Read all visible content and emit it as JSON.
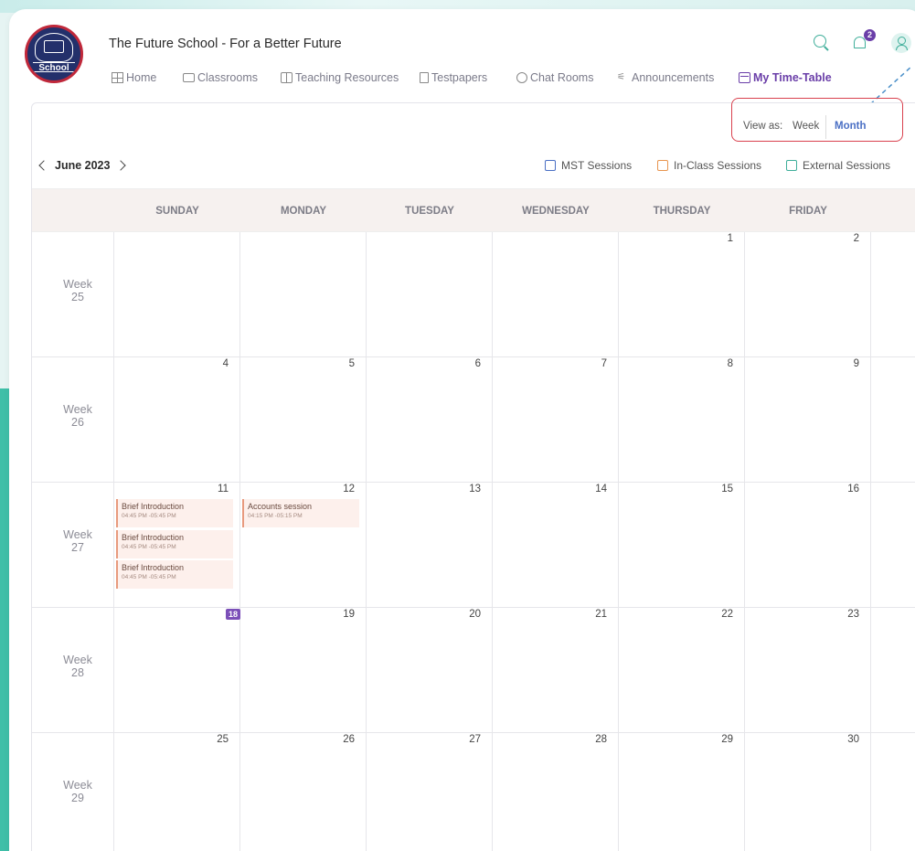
{
  "header": {
    "school_title": "The Future School - For a Better Future",
    "logo_text": "School",
    "notification_count": "2"
  },
  "nav": [
    {
      "label": "Home",
      "icon": "home-grid-icon"
    },
    {
      "label": "Classrooms",
      "icon": "classroom-screen-icon"
    },
    {
      "label": "Teaching Resources",
      "icon": "book-icon"
    },
    {
      "label": "Testpapers",
      "icon": "testpaper-icon"
    },
    {
      "label": "Chat Rooms",
      "icon": "chat-icon"
    },
    {
      "label": "Announcements",
      "icon": "megaphone-icon"
    },
    {
      "label": "My Time-Table",
      "icon": "calendar-icon",
      "active": true
    }
  ],
  "view_as": {
    "label": "View as:",
    "week": "Week",
    "month": "Month",
    "selected": "Month"
  },
  "calendar": {
    "month_label": "June 2023",
    "legend": [
      {
        "label": "MST Sessions",
        "color": "#4a6fc4"
      },
      {
        "label": "In-Class Sessions",
        "color": "#e8954f"
      },
      {
        "label": "External Sessions",
        "color": "#3fae9a"
      }
    ],
    "days_of_week": [
      "SUNDAY",
      "MONDAY",
      "TUESDAY",
      "WEDNESDAY",
      "THURSDAY",
      "FRIDAY"
    ],
    "weeks": [
      {
        "label": "Week",
        "num": "25",
        "days": [
          "",
          "",
          "",
          "",
          "1",
          "2"
        ]
      },
      {
        "label": "Week",
        "num": "26",
        "days": [
          "4",
          "5",
          "6",
          "7",
          "8",
          "9"
        ]
      },
      {
        "label": "Week",
        "num": "27",
        "days": [
          "11",
          "12",
          "13",
          "14",
          "15",
          "16"
        ]
      },
      {
        "label": "Week",
        "num": "28",
        "days": [
          "18",
          "19",
          "20",
          "21",
          "22",
          "23"
        ]
      },
      {
        "label": "Week",
        "num": "29",
        "days": [
          "25",
          "26",
          "27",
          "28",
          "29",
          "30"
        ]
      }
    ],
    "today": "18",
    "events": [
      {
        "title": "Brief Introduction",
        "time": "04:45 PM -05:45 PM",
        "day": "11"
      },
      {
        "title": "Brief Introduction",
        "time": "04:45 PM -05:45 PM",
        "day": "11"
      },
      {
        "title": "Brief Introduction",
        "time": "04:45 PM -05:45 PM",
        "day": "11"
      },
      {
        "title": "Accounts session",
        "time": "04:15 PM -05:15 PM",
        "day": "12"
      }
    ]
  },
  "colors": {
    "accent": "#6a3ea8",
    "teal": "#3fae9a",
    "event_bg": "#fdf0ec",
    "highlight_border": "#d9414e"
  }
}
